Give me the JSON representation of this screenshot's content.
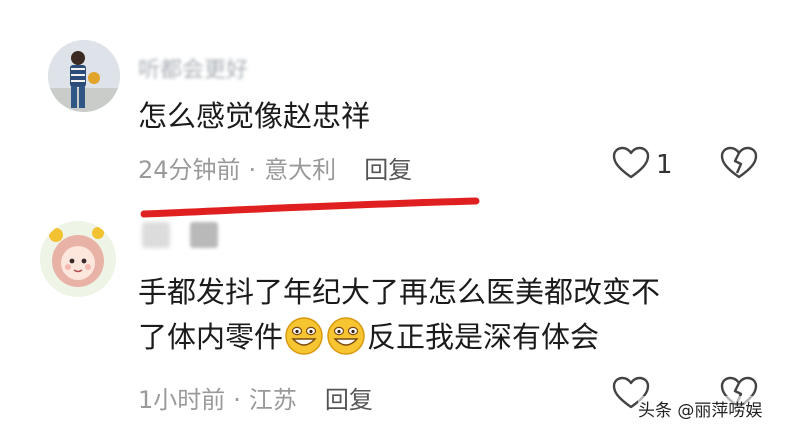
{
  "comments": [
    {
      "username": "听都会更好",
      "text": "怎么感觉像赵忠祥",
      "time": "24分钟前",
      "location": "意大利",
      "reply_label": "回复",
      "like_count": "1"
    },
    {
      "text_line1": "手都发抖了年纪大了再怎么医美都改变不",
      "text_line2_a": "了体内零件",
      "text_line2_b": "反正我是深有体会",
      "time": "1小时前",
      "location": "江苏",
      "reply_label": "回复"
    }
  ],
  "separator": "·",
  "watermark": "头条 @丽萍唠娱",
  "colors": {
    "underline": "#e02020",
    "meta": "#9a9a9a",
    "text": "#1b1b1b"
  },
  "icons": [
    "heart-outline-icon",
    "broken-heart-icon",
    "grin-emoji-icon"
  ]
}
